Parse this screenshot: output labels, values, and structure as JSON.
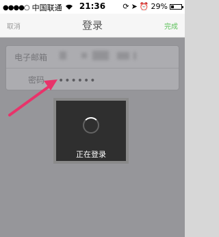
{
  "status_bar": {
    "carrier": "中国联通",
    "time": "21:36",
    "battery_percent": "29%",
    "battery_level": 0.29
  },
  "nav": {
    "cancel_label": "取消",
    "title": "登录",
    "done_label": "完成",
    "done_color": "#5fc15c"
  },
  "form": {
    "email_label": "电子邮箱",
    "password_label": "密码",
    "password_value": "••••••"
  },
  "hud": {
    "loading_text": "正在登录"
  },
  "annotation": {
    "arrow_color": "#e8336a"
  }
}
